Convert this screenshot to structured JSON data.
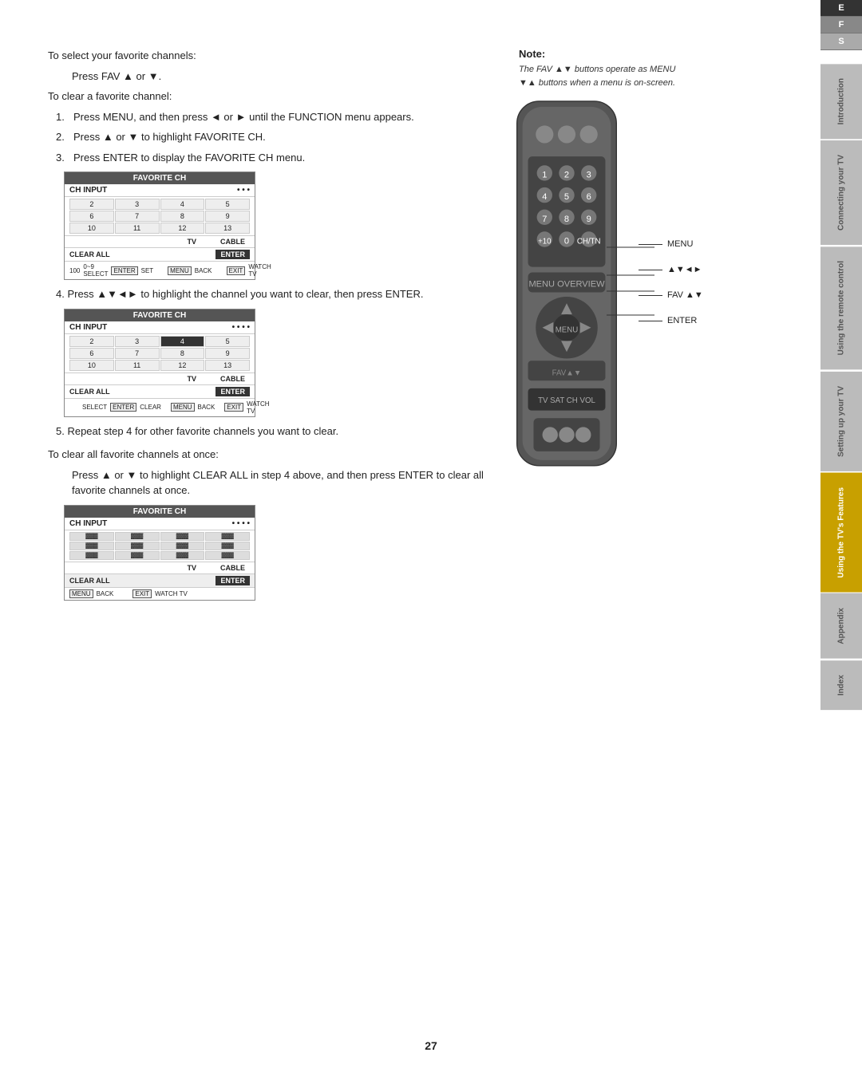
{
  "page": {
    "number": "27"
  },
  "efs": {
    "e": "E",
    "f": "F",
    "s": "S"
  },
  "sidebar": {
    "tabs": [
      {
        "label": "Introduction",
        "state": "inactive"
      },
      {
        "label": "Connecting your TV",
        "state": "inactive"
      },
      {
        "label": "Using the remote control",
        "state": "inactive"
      },
      {
        "label": "Setting up your TV",
        "state": "inactive"
      },
      {
        "label": "Using the TV's Features",
        "state": "active"
      },
      {
        "label": "Appendix",
        "state": "inactive"
      },
      {
        "label": "Index",
        "state": "inactive"
      }
    ]
  },
  "main": {
    "intro_line": "To select your favorite channels:",
    "press_fav": "Press FAV ▲ or ▼.",
    "clear_line": "To clear a favorite channel:",
    "steps": [
      {
        "num": "1.",
        "text": "Press MENU, and then press ◄ or ► until the FUNCTION menu appears."
      },
      {
        "num": "2.",
        "text": "Press ▲ or ▼ to highlight FAVORITE CH."
      },
      {
        "num": "3.",
        "text": "Press ENTER to display the FAVORITE CH menu."
      }
    ],
    "step4": "4.  Press ▲▼◄► to highlight the channel you want to clear, then press ENTER.",
    "step5": "5.  Repeat step 4 for other favorite channels you want to clear.",
    "clear_all_intro": "To clear all favorite channels at once:",
    "clear_all_desc": "Press ▲ or ▼ to highlight CLEAR ALL in step 4 above, and then press ENTER to clear all favorite channels at once."
  },
  "note": {
    "title": "Note:",
    "text": "The FAV ▲▼ buttons operate as MENU ▼▲ buttons when a menu is on-screen."
  },
  "remote_labels": {
    "menu": "MENU",
    "nav": "▲▼◄►",
    "fav": "FAV ▲▼",
    "enter": "ENTER"
  },
  "fav_menu1": {
    "title": "FAVORITE CH",
    "header_ch": "CH INPUT",
    "header_dots": "• • •",
    "rows": [
      [
        "2",
        "3",
        "4",
        "5"
      ],
      [
        "6",
        "7",
        "8",
        "9"
      ],
      [
        "10",
        "11",
        "12",
        "13"
      ]
    ],
    "cols": [
      "TV",
      "CABLE"
    ],
    "clear_all": "CLEAR ALL",
    "enter_btn": "ENTER",
    "legend": "100 0~9 SELECT  ENTER SET",
    "menu_back": "MENU BACK",
    "exit": "EXIT WATCH TV"
  },
  "fav_menu2": {
    "title": "FAVORITE CH",
    "header_ch": "CH INPUT",
    "header_dots": "• • •",
    "selected_row": 0,
    "selected_col": 2,
    "rows": [
      [
        "2",
        "3",
        "4",
        "5"
      ],
      [
        "6",
        "7",
        "8",
        "9"
      ],
      [
        "10",
        "11",
        "12",
        "13"
      ]
    ],
    "cols": [
      "TV",
      "CABLE"
    ],
    "clear_all": "CLEAR ALL",
    "enter_btn": "ENTER",
    "legend": "● ● ● ● SELECT  ENTER CLEAR",
    "menu_back": "MENU BACK",
    "exit": "EXIT WATCH TV"
  },
  "fav_menu3": {
    "title": "FAVORITE CH",
    "header_ch": "CH INPUT",
    "header_dots": "• • •",
    "rows": [
      [
        "",
        "",
        "",
        ""
      ],
      [
        "",
        "",
        "",
        ""
      ],
      [
        "",
        "",
        "",
        ""
      ]
    ],
    "cols": [
      "TV",
      "CABLE"
    ],
    "clear_all": "CLEAR ALL",
    "enter_btn": "ENTER",
    "menu_back": "MENU BACK",
    "exit": "EXIT WATCH TV"
  }
}
